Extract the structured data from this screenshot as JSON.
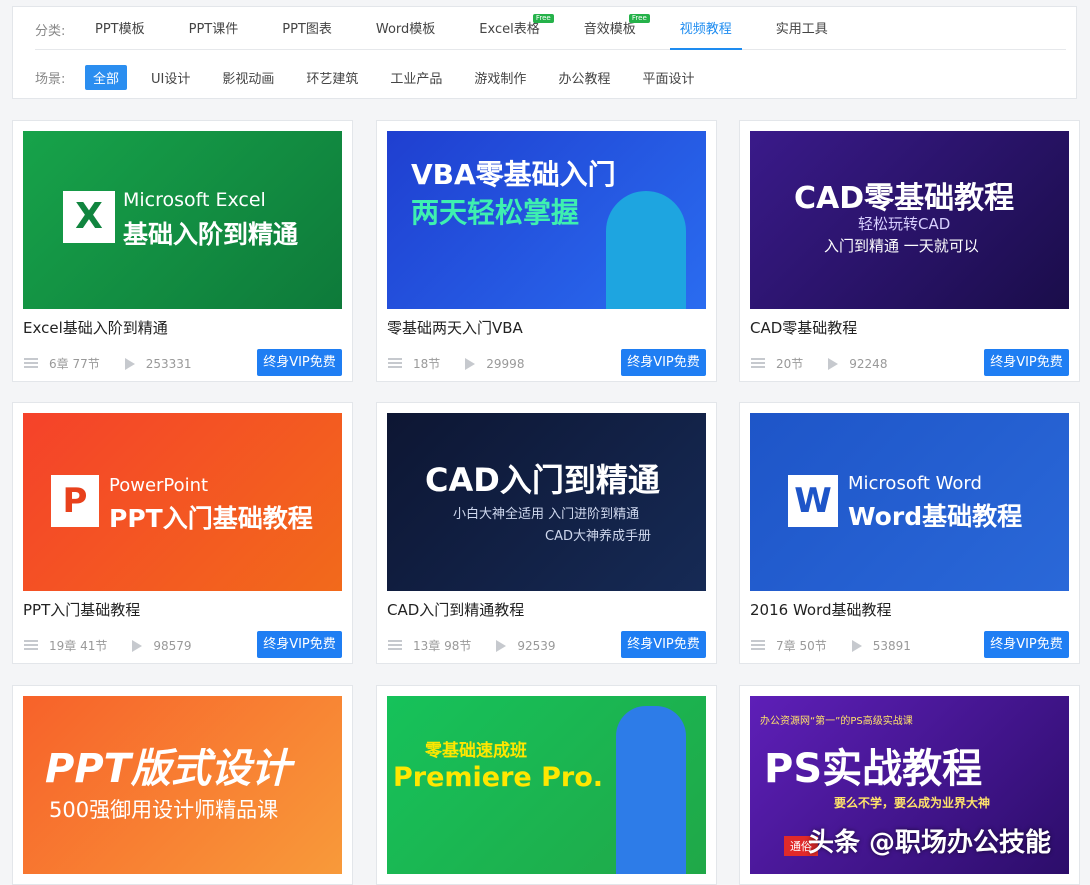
{
  "filters": {
    "category_label": "分类:",
    "categories": [
      {
        "label": "PPT模板",
        "free": ""
      },
      {
        "label": "PPT课件",
        "free": ""
      },
      {
        "label": "PPT图表",
        "free": ""
      },
      {
        "label": "Word模板",
        "free": ""
      },
      {
        "label": "Excel表格",
        "free": "Free"
      },
      {
        "label": "音效模板",
        "free": "Free"
      },
      {
        "label": "视频教程",
        "free": ""
      },
      {
        "label": "实用工具",
        "free": ""
      }
    ],
    "active_category": "视频教程",
    "scene_label": "场景:",
    "scenes": [
      "全部",
      "UI设计",
      "影视动画",
      "环艺建筑",
      "工业产品",
      "游戏制作",
      "办公教程",
      "平面设计"
    ],
    "active_scene": "全部"
  },
  "vip_label": "终身VIP免费",
  "courses": [
    {
      "title": "Excel基础入阶到精通",
      "chapters": "6章 77节",
      "views": "253331",
      "thumb": {
        "line1": "Microsoft Excel",
        "line2": "基础入阶到精通",
        "logo": "X"
      }
    },
    {
      "title": "零基础两天入门VBA",
      "chapters": "18节",
      "views": "29998",
      "thumb": {
        "line1": "VBA零基础入门",
        "line2": "两天轻松掌握"
      }
    },
    {
      "title": "CAD零基础教程",
      "chapters": "20节",
      "views": "92248",
      "thumb": {
        "line1": "CAD零基础教程",
        "line2": "轻松玩转CAD",
        "line3": "入门到精通 一天就可以"
      }
    },
    {
      "title": "PPT入门基础教程",
      "chapters": "19章 41节",
      "views": "98579",
      "thumb": {
        "line1": "PowerPoint",
        "line2": "PPT入门基础教程",
        "logo": "P"
      }
    },
    {
      "title": "CAD入门到精通教程",
      "chapters": "13章 98节",
      "views": "92539",
      "thumb": {
        "line1": "CAD入门到精通",
        "line2": "小白大神全适用 入门进阶到精通",
        "line3": "CAD大神养成手册"
      }
    },
    {
      "title": "2016 Word基础教程",
      "chapters": "7章 50节",
      "views": "53891",
      "thumb": {
        "line1": "Microsoft Word",
        "line2": "Word基础教程",
        "logo": "W"
      }
    },
    {
      "thumb": {
        "line1": "PPT版式设计",
        "line2": "500强御用设计师精品课"
      }
    },
    {
      "thumb": {
        "line1": "零基础速成班",
        "line2": "Premiere Pro."
      }
    },
    {
      "thumb": {
        "line1": "办公资源网“第一”的PS高级实战课",
        "line2": "PS实战教程",
        "line3": "要么不学，要么成为业界大神",
        "line4": "通俗"
      }
    }
  ],
  "watermark": "头条 @职场办公技能",
  "colors": {
    "accent": "#1e8cf0",
    "vip": "#1f7ef3",
    "free": "#25b24a"
  }
}
